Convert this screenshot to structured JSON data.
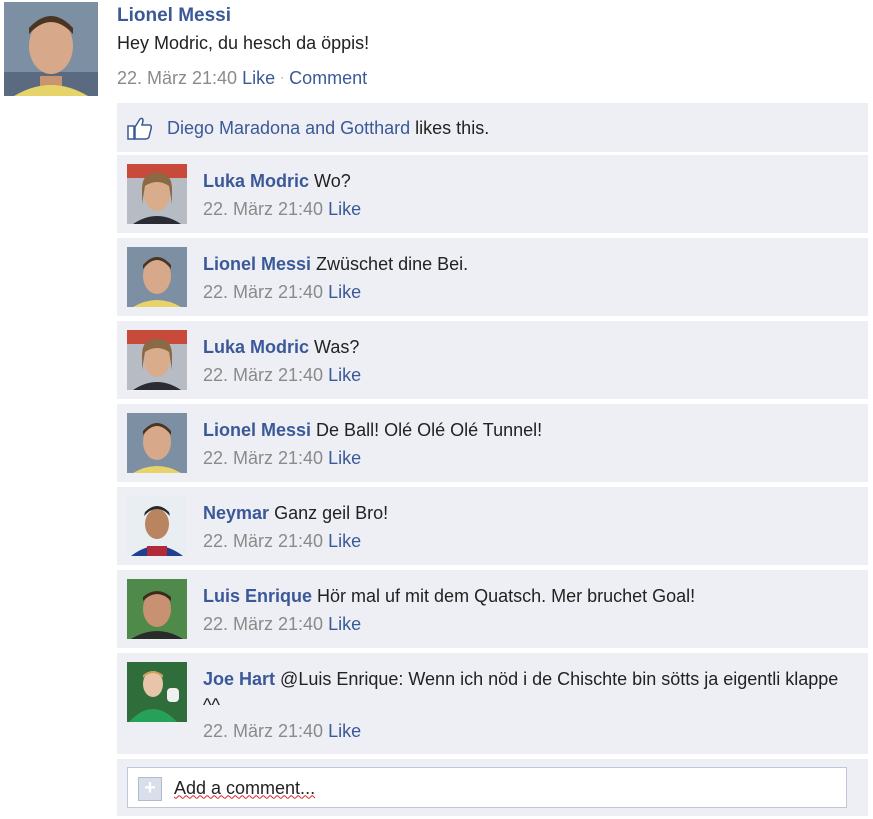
{
  "post": {
    "author": "Lionel Messi",
    "text": "Hey Modric, du hesch da öppis!",
    "timestamp": "22. März 21:40",
    "like_label": "Like",
    "separator": "·",
    "comment_label": "Comment"
  },
  "likes": {
    "names": "Diego Maradona and Gotthard",
    "suffix": " likes this."
  },
  "comments": [
    {
      "author": "Luka Modric",
      "text": "Wo?",
      "timestamp": "22. März 21:40",
      "like_label": "Like"
    },
    {
      "author": "Lionel Messi",
      "text": "Zwüschet dine Bei.",
      "timestamp": "22. März 21:40",
      "like_label": "Like"
    },
    {
      "author": "Luka Modric",
      "text": "Was?",
      "timestamp": "22. März 21:40",
      "like_label": "Like"
    },
    {
      "author": "Lionel Messi",
      "text": "De Ball! Olé Olé Olé Tunnel!",
      "timestamp": "22. März 21:40",
      "like_label": "Like"
    },
    {
      "author": "Neymar",
      "text": "Ganz geil Bro!",
      "timestamp": "22. März 21:40",
      "like_label": "Like"
    },
    {
      "author": "Luis Enrique",
      "text": "Hör mal uf mit dem Quatsch. Mer bruchet Goal!",
      "timestamp": "22. März 21:40",
      "like_label": "Like"
    },
    {
      "author": "Joe Hart",
      "text": "@Luis Enrique: Wenn ich nöd i de Chischte bin sötts ja eigentli klappe ^^",
      "timestamp": "22. März 21:40",
      "like_label": "Like"
    }
  ],
  "add_comment": {
    "placeholder": "Add a comment..."
  },
  "colors": {
    "link": "#3b5998",
    "row_bg": "#edeff4",
    "meta_text": "#8a8a8a"
  }
}
